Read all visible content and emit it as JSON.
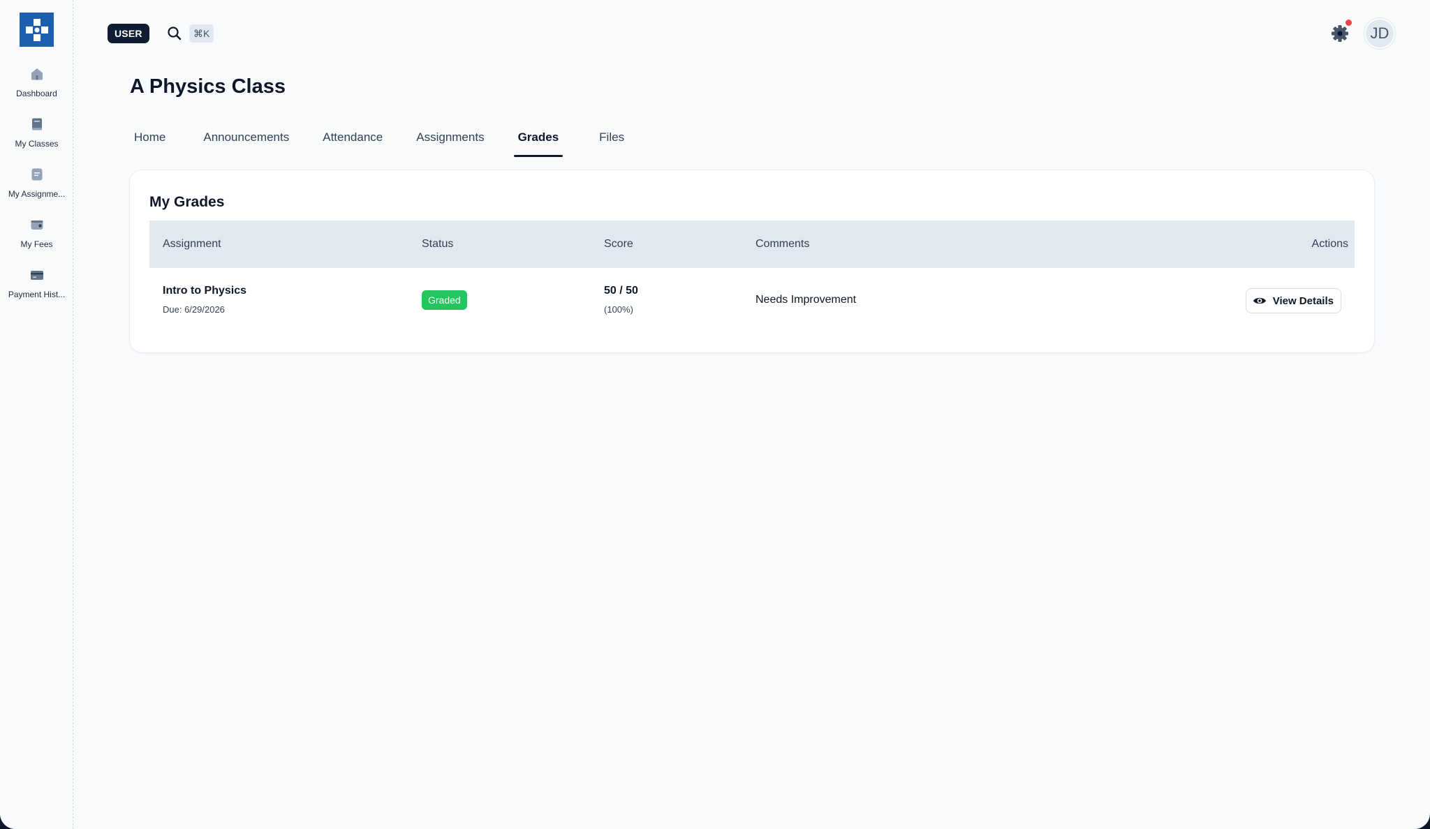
{
  "sidebar": {
    "items": [
      {
        "label": "Dashboard",
        "icon": "home-icon"
      },
      {
        "label": "My Classes",
        "icon": "book-icon"
      },
      {
        "label": "My Assignme...",
        "icon": "document-icon"
      },
      {
        "label": "My Fees",
        "icon": "wallet-icon"
      },
      {
        "label": "Payment Hist...",
        "icon": "credit-card-icon"
      }
    ]
  },
  "header": {
    "role_badge": "USER",
    "search_shortcut": "⌘K",
    "avatar_initials": "JD"
  },
  "page": {
    "title": "A Physics Class",
    "tabs": [
      "Home",
      "Announcements",
      "Attendance",
      "Assignments",
      "Grades",
      "Files"
    ],
    "active_tab": "Grades"
  },
  "grades": {
    "title": "My Grades",
    "columns": [
      "Assignment",
      "Status",
      "Score",
      "Comments",
      "Actions"
    ],
    "rows": [
      {
        "assignment": "Intro to Physics",
        "due": "Due: 6/29/2026",
        "status": "Graded",
        "score": "50 / 50",
        "percent": "(100%)",
        "comment": "Needs Improvement",
        "action": "View Details"
      }
    ]
  },
  "colors": {
    "brand": "#1b5fae",
    "status_graded": "#22c55e",
    "notification": "#ef4444",
    "header_row": "#e2e8f0"
  }
}
